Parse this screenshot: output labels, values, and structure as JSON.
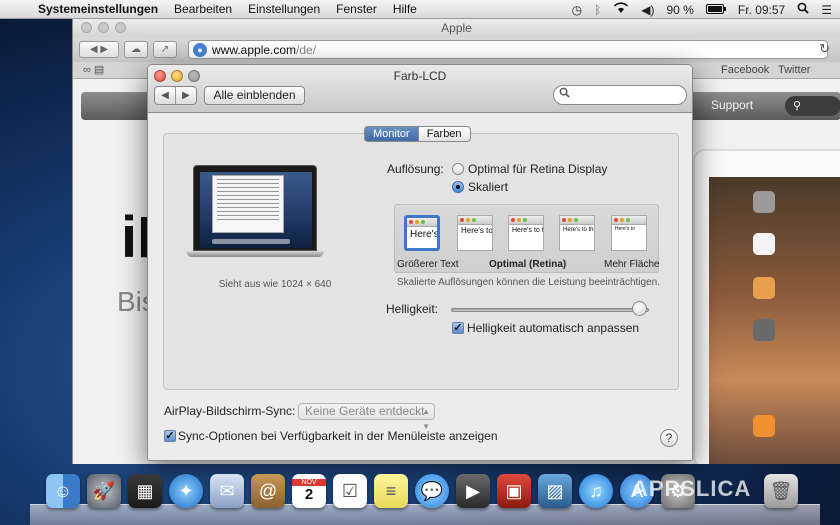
{
  "menubar": {
    "app": "Systemeinstellungen",
    "items": [
      "Bearbeiten",
      "Einstellungen",
      "Fenster",
      "Hilfe"
    ],
    "battery": "90 %",
    "clock": "Fr. 09:57",
    "status_icons": [
      "time-machine-icon",
      "bluetooth-icon",
      "wifi-icon",
      "volume-icon",
      "battery-icon",
      "spotlight-icon",
      "list-icon"
    ]
  },
  "browser": {
    "title": "Apple",
    "url_host": "www.apple.com",
    "url_path": "/de/",
    "bookmarks": [
      "Facebook",
      "Twitter"
    ],
    "nav_support": "Support",
    "hero_big": "iP",
    "hero_sub": "Bis"
  },
  "prefs": {
    "title": "Farb-LCD",
    "show_all": "Alle einblenden",
    "search_placeholder": "",
    "tabs": [
      "Monitor",
      "Farben"
    ],
    "active_tab": "Monitor",
    "looks_like": "Sieht aus wie 1024 × 640",
    "resolution_label": "Auflösung:",
    "resolution_options": [
      "Optimal für Retina Display",
      "Skaliert"
    ],
    "resolution_selected": "Skaliert",
    "thumbs": [
      "Here's",
      "Here's to",
      "Here's to th",
      "Here's to the",
      "Here's to"
    ],
    "thumb_labels": [
      "Größerer Text",
      "Optimal (Retina)",
      "Mehr Fläche"
    ],
    "thumb_note": "Skalierte Auflösungen können die Leistung beeinträchtigen.",
    "brightness_label": "Helligkeit:",
    "brightness_level": 0.95,
    "auto_brightness": "Helligkeit automatisch anpassen",
    "auto_brightness_checked": true,
    "airplay_label": "AirPlay-Bildschirm-Sync:",
    "airplay_value": "Keine Geräte entdeckt",
    "sync_options": "Sync-Optionen bei Verfügbarkeit in der Menüleiste anzeigen",
    "sync_checked": true,
    "help": "?"
  },
  "dock": {
    "apps": [
      "finder-icon",
      "launchpad-icon",
      "mission-control-icon",
      "safari-icon",
      "mail-icon",
      "contacts-icon",
      "calendar-icon",
      "reminders-icon",
      "notes-icon",
      "messages-icon",
      "facetime-icon",
      "photo-booth-icon",
      "iphoto-icon",
      "itunes-icon",
      "app-store-icon",
      "system-preferences-icon",
      "trash-icon"
    ],
    "calendar_month": "NOV",
    "calendar_day": "2"
  },
  "watermark": "APPSLICA"
}
